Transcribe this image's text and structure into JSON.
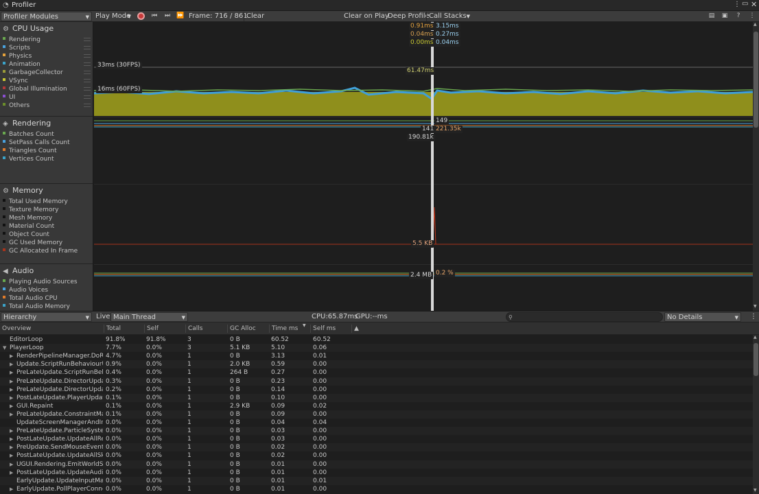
{
  "window": {
    "title": "Profiler"
  },
  "toolbar": {
    "modules_dropdown": "Profiler Modules",
    "play_mode": "Play Mode",
    "frame_label": "Frame: 716 / 861",
    "clear": "Clear",
    "clear_on_play": "Clear on Play",
    "deep_profile": "Deep Profile",
    "call_stacks": "Call Stacks"
  },
  "modules": [
    {
      "name": "CPU Usage",
      "icon": "cpu-icon",
      "legend": [
        {
          "label": "Rendering",
          "color": "#6aa84f"
        },
        {
          "label": "Scripts",
          "color": "#4aa3df"
        },
        {
          "label": "Physics",
          "color": "#e5a23c"
        },
        {
          "label": "Animation",
          "color": "#3ba3c9"
        },
        {
          "label": "GarbageCollector",
          "color": "#9a9a3a"
        },
        {
          "label": "VSync",
          "color": "#c8c832"
        },
        {
          "label": "Global Illumination",
          "color": "#b23a3a"
        },
        {
          "label": "UI",
          "color": "#8a4fd0"
        },
        {
          "label": "Others",
          "color": "#6b8f2a"
        }
      ]
    },
    {
      "name": "Rendering",
      "icon": "rendering-icon",
      "legend": [
        {
          "label": "Batches Count",
          "color": "#6aa84f"
        },
        {
          "label": "SetPass Calls Count",
          "color": "#4aa3df"
        },
        {
          "label": "Triangles Count",
          "color": "#e07b2a"
        },
        {
          "label": "Vertices Count",
          "color": "#3ba3c9"
        }
      ]
    },
    {
      "name": "Memory",
      "icon": "memory-icon",
      "legend": [
        {
          "label": "Total Used Memory",
          "color": "#111111"
        },
        {
          "label": "Texture Memory",
          "color": "#111111"
        },
        {
          "label": "Mesh Memory",
          "color": "#111111"
        },
        {
          "label": "Material Count",
          "color": "#111111"
        },
        {
          "label": "Object Count",
          "color": "#111111"
        },
        {
          "label": "GC Used Memory",
          "color": "#111111"
        },
        {
          "label": "GC Allocated In Frame",
          "color": "#a8341c"
        }
      ]
    },
    {
      "name": "Audio",
      "icon": "audio-icon",
      "legend": [
        {
          "label": "Playing Audio Sources",
          "color": "#6aa84f"
        },
        {
          "label": "Audio Voices",
          "color": "#4aa3df"
        },
        {
          "label": "Total Audio CPU",
          "color": "#e07b2a"
        },
        {
          "label": "Total Audio Memory",
          "color": "#3ba3c9"
        }
      ]
    }
  ],
  "graph_labels": {
    "cpu_top": [
      "0.91ms",
      "0.04ms",
      "0.00ms"
    ],
    "cpu_top_right": [
      "3.15ms",
      "0.27ms",
      "0.04ms"
    ],
    "fps30": "33ms (30FPS)",
    "fps60": "16ms (60FPS)",
    "cpu_total": "61.47ms",
    "rend_a": "149",
    "rend_b": "141",
    "rend_c": "221.35k",
    "rend_d": "190.81k",
    "mem_gc": "5.5 KB",
    "audio_mem": "2.4 MB",
    "audio_cpu": "0.2 %"
  },
  "colors": {
    "cpu_fill": "#9a9a1f",
    "scripts": "#4aa3df",
    "rendering": "#6aa84f",
    "gc_line": "#a8341c"
  },
  "bottom": {
    "view": "Hierarchy",
    "live": "Live",
    "thread": "Main Thread",
    "cpu": "CPU:65.87ms",
    "gpu": "GPU:--ms",
    "search_placeholder": "",
    "details": "No Details"
  },
  "table": {
    "columns": [
      "Overview",
      "Total",
      "Self",
      "Calls",
      "GC Alloc",
      "Time ms",
      "Self ms"
    ],
    "rows": [
      {
        "indent": 0,
        "arrow": "",
        "name": "EditorLoop",
        "total": "91.8%",
        "self": "91.8%",
        "calls": "3",
        "gc": "0 B",
        "time": "60.52",
        "selfms": "60.52"
      },
      {
        "indent": 0,
        "arrow": "▼",
        "name": "PlayerLoop",
        "total": "7.7%",
        "self": "0.0%",
        "calls": "3",
        "gc": "5.1 KB",
        "time": "5.10",
        "selfms": "0.06"
      },
      {
        "indent": 1,
        "arrow": "▶",
        "name": "RenderPipelineManager.DoRe",
        "total": "4.7%",
        "self": "0.0%",
        "calls": "1",
        "gc": "0 B",
        "time": "3.13",
        "selfms": "0.01"
      },
      {
        "indent": 1,
        "arrow": "▶",
        "name": "Update.ScriptRunBehaviourU",
        "total": "0.9%",
        "self": "0.0%",
        "calls": "1",
        "gc": "2.0 KB",
        "time": "0.59",
        "selfms": "0.00"
      },
      {
        "indent": 1,
        "arrow": "▶",
        "name": "PreLateUpdate.ScriptRunBeh",
        "total": "0.4%",
        "self": "0.0%",
        "calls": "1",
        "gc": "264 B",
        "time": "0.27",
        "selfms": "0.00"
      },
      {
        "indent": 1,
        "arrow": "▶",
        "name": "PreLateUpdate.DirectorUpdat",
        "total": "0.3%",
        "self": "0.0%",
        "calls": "1",
        "gc": "0 B",
        "time": "0.23",
        "selfms": "0.00"
      },
      {
        "indent": 1,
        "arrow": "▶",
        "name": "PreLateUpdate.DirectorUpdat",
        "total": "0.2%",
        "self": "0.0%",
        "calls": "1",
        "gc": "0 B",
        "time": "0.14",
        "selfms": "0.00"
      },
      {
        "indent": 1,
        "arrow": "▶",
        "name": "PostLateUpdate.PlayerUpdat",
        "total": "0.1%",
        "self": "0.0%",
        "calls": "1",
        "gc": "0 B",
        "time": "0.10",
        "selfms": "0.00"
      },
      {
        "indent": 1,
        "arrow": "▶",
        "name": "GUI.Repaint",
        "total": "0.1%",
        "self": "0.0%",
        "calls": "1",
        "gc": "2.9 KB",
        "time": "0.09",
        "selfms": "0.02"
      },
      {
        "indent": 1,
        "arrow": "▶",
        "name": "PreLateUpdate.ConstraintMa",
        "total": "0.1%",
        "self": "0.0%",
        "calls": "1",
        "gc": "0 B",
        "time": "0.09",
        "selfms": "0.00"
      },
      {
        "indent": 1,
        "arrow": "",
        "name": "UpdateScreenManagerAndIn",
        "total": "0.0%",
        "self": "0.0%",
        "calls": "1",
        "gc": "0 B",
        "time": "0.04",
        "selfms": "0.04"
      },
      {
        "indent": 1,
        "arrow": "▶",
        "name": "PreLateUpdate.ParticleSyste",
        "total": "0.0%",
        "self": "0.0%",
        "calls": "1",
        "gc": "0 B",
        "time": "0.03",
        "selfms": "0.00"
      },
      {
        "indent": 1,
        "arrow": "▶",
        "name": "PostLateUpdate.UpdateAllRe",
        "total": "0.0%",
        "self": "0.0%",
        "calls": "1",
        "gc": "0 B",
        "time": "0.03",
        "selfms": "0.00"
      },
      {
        "indent": 1,
        "arrow": "▶",
        "name": "PreUpdate.SendMouseEvents",
        "total": "0.0%",
        "self": "0.0%",
        "calls": "1",
        "gc": "0 B",
        "time": "0.02",
        "selfms": "0.00"
      },
      {
        "indent": 1,
        "arrow": "▶",
        "name": "PostLateUpdate.UpdateAllSki",
        "total": "0.0%",
        "self": "0.0%",
        "calls": "1",
        "gc": "0 B",
        "time": "0.02",
        "selfms": "0.00"
      },
      {
        "indent": 1,
        "arrow": "▶",
        "name": "UGUI.Rendering.EmitWorldSc",
        "total": "0.0%",
        "self": "0.0%",
        "calls": "1",
        "gc": "0 B",
        "time": "0.01",
        "selfms": "0.00"
      },
      {
        "indent": 1,
        "arrow": "▶",
        "name": "PostLateUpdate.UpdateAudio",
        "total": "0.0%",
        "self": "0.0%",
        "calls": "1",
        "gc": "0 B",
        "time": "0.01",
        "selfms": "0.00"
      },
      {
        "indent": 1,
        "arrow": "",
        "name": "EarlyUpdate.UpdateInputMan",
        "total": "0.0%",
        "self": "0.0%",
        "calls": "1",
        "gc": "0 B",
        "time": "0.01",
        "selfms": "0.01"
      },
      {
        "indent": 1,
        "arrow": "▶",
        "name": "EarlyUpdate.PollPlayerConne",
        "total": "0.0%",
        "self": "0.0%",
        "calls": "1",
        "gc": "0 B",
        "time": "0.01",
        "selfms": "0.00"
      }
    ]
  }
}
